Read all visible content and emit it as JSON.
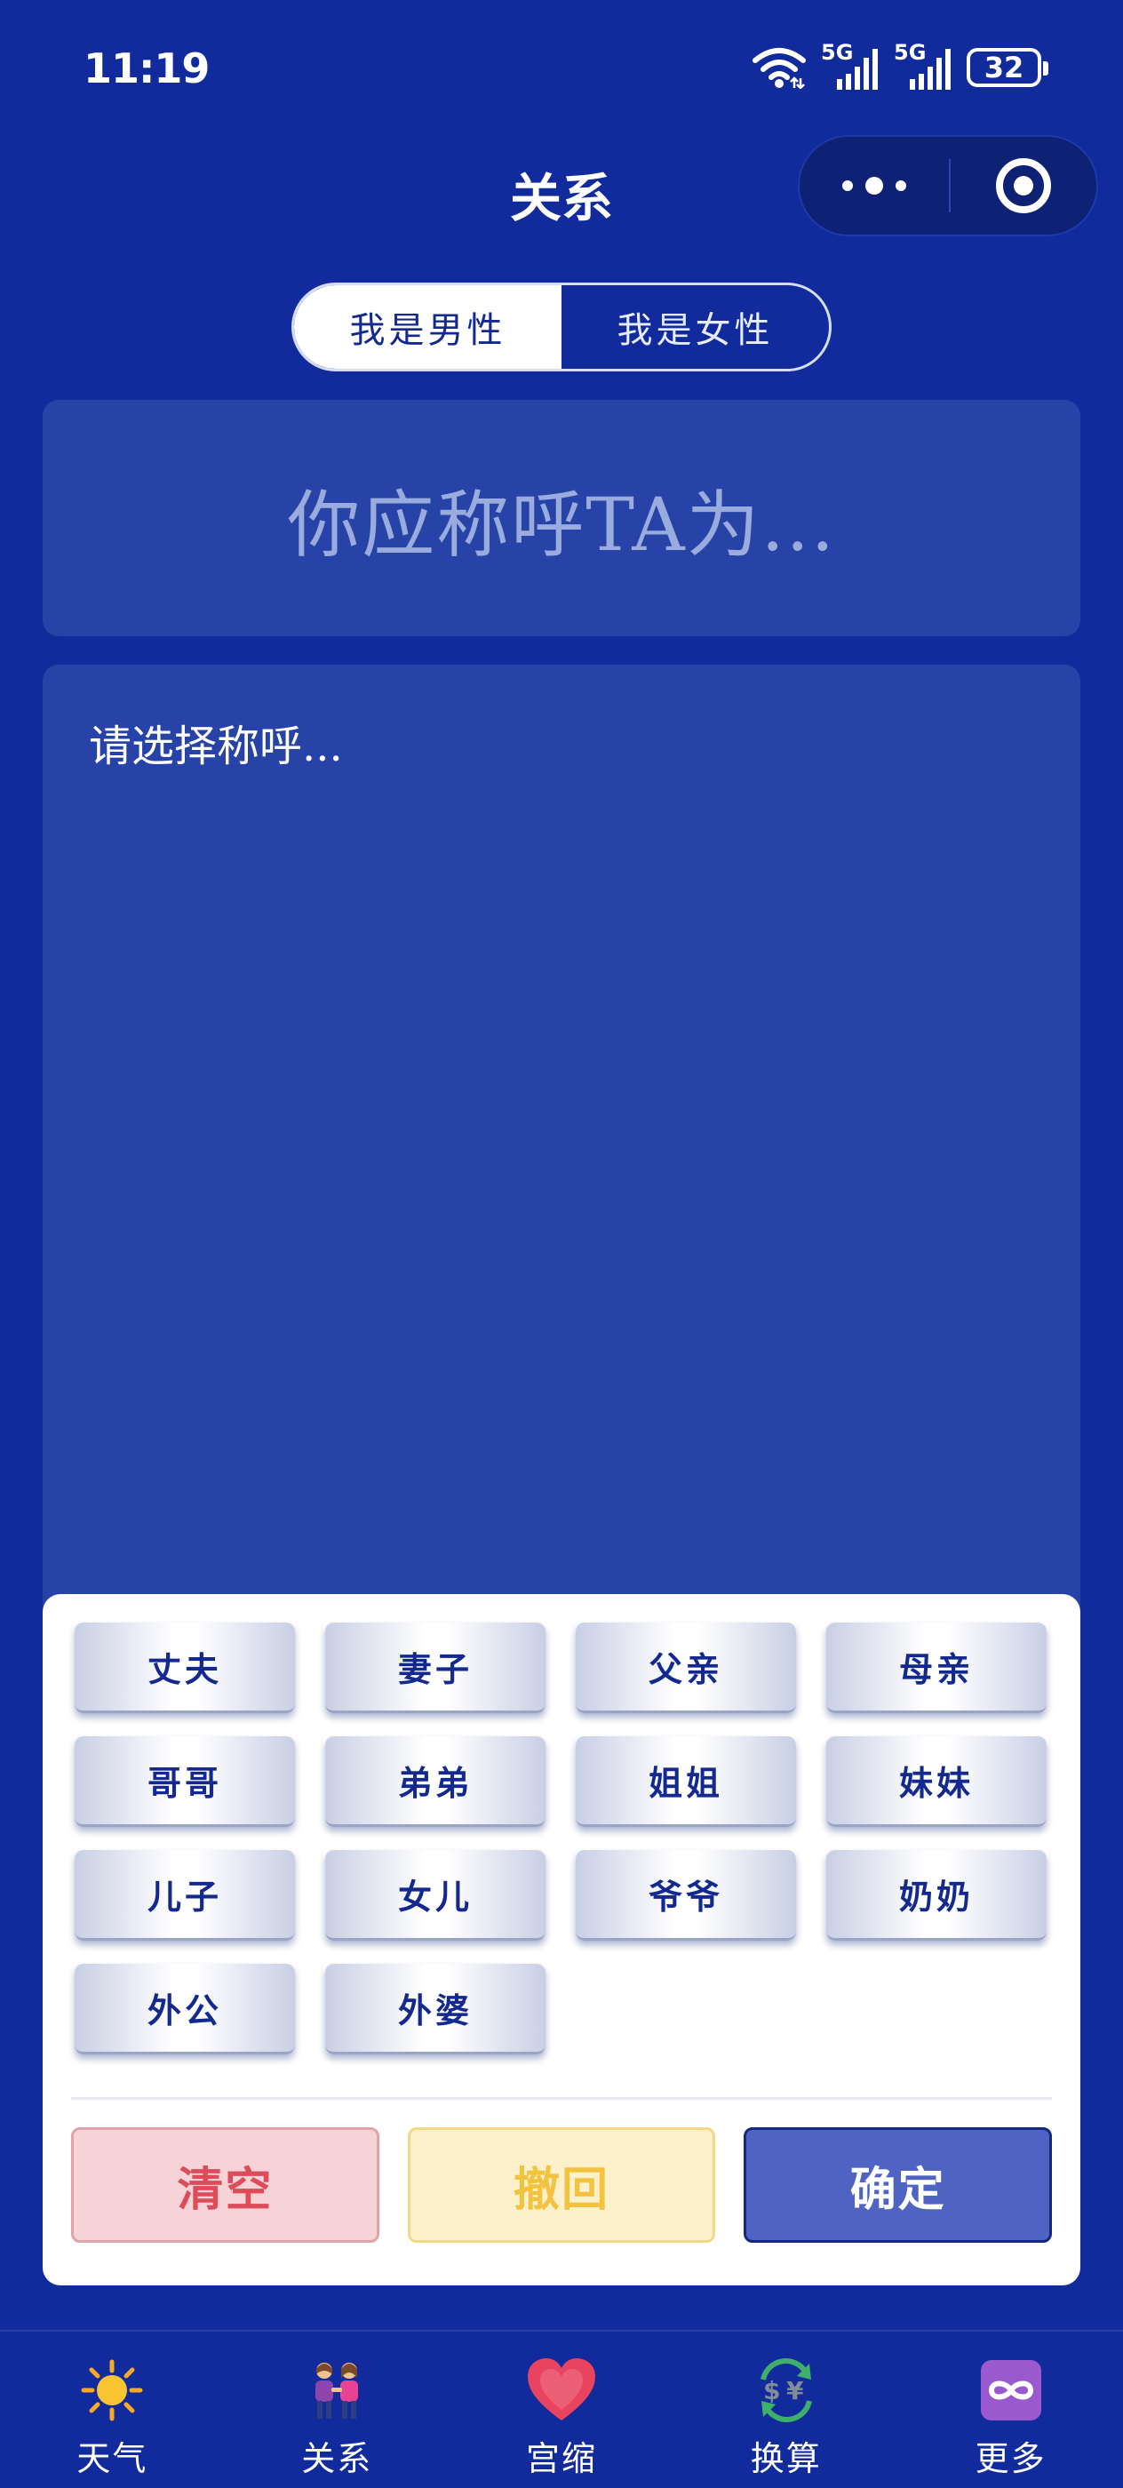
{
  "status_bar": {
    "time": "11:19",
    "net1": "5G",
    "net2": "5G",
    "battery": "32"
  },
  "header": {
    "title": "关系"
  },
  "gender": {
    "male": "我是男性",
    "female": "我是女性",
    "selected": "male"
  },
  "result": {
    "placeholder": "你应称呼TA为..."
  },
  "chain": {
    "placeholder": "请选择称呼..."
  },
  "keyboard": {
    "keys": [
      "丈夫",
      "妻子",
      "父亲",
      "母亲",
      "哥哥",
      "弟弟",
      "姐姐",
      "妹妹",
      "儿子",
      "女儿",
      "爷爷",
      "奶奶",
      "外公",
      "外婆"
    ],
    "clear": "清空",
    "undo": "撤回",
    "confirm": "确定"
  },
  "tabs": [
    {
      "label": "天气",
      "icon": "sun-icon"
    },
    {
      "label": "关系",
      "icon": "couple-icon"
    },
    {
      "label": "宫缩",
      "icon": "heart-icon"
    },
    {
      "label": "换算",
      "icon": "currency-exchange-icon"
    },
    {
      "label": "更多",
      "icon": "infinity-icon"
    }
  ],
  "colors": {
    "background": "#112a9c",
    "card": "#2843a8",
    "key_text": "#13298f",
    "clear": "#dc4c5b",
    "undo": "#f3c33f",
    "confirm": "#4f64c2"
  }
}
